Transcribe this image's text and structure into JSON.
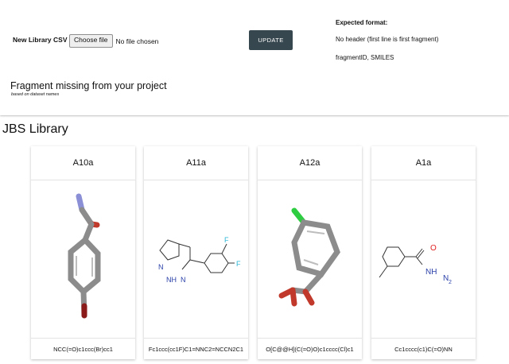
{
  "upload": {
    "label": "New Library CSV",
    "choose_label": "Choose file",
    "no_file_text": "No file chosen",
    "update_label": "UPDATE"
  },
  "format": {
    "title": "Expected format:",
    "line1": "No header (first line is first fragment)",
    "line2": "fragmentID, SMILES"
  },
  "missing": {
    "title": "Fragment missing from your project",
    "subtitle": "based on dataset names"
  },
  "library": {
    "title": "JBS Library",
    "cards": [
      {
        "id": "A10a",
        "smiles": "NCC(=O)c1ccc(Br)cc1",
        "image": "3d-stick-model"
      },
      {
        "id": "A11a",
        "smiles": "Fc1ccc(cc1F)C1=NNC2=NCCN2C1",
        "image": "2d-structure",
        "atom_labels": {
          "f1": "F",
          "f2": "F",
          "n1": "N",
          "n2": "NH",
          "n3": "N"
        }
      },
      {
        "id": "A12a",
        "smiles": "O[C@@H](C(=O)O)c1cccc(Cl)c1",
        "image": "3d-stick-model"
      },
      {
        "id": "A1a",
        "smiles": "Cc1cccc(c1)C(=O)NN",
        "image": "2d-structure",
        "atom_labels": {
          "o": "O",
          "nh": "NH",
          "n": "N",
          "h2": "2"
        }
      }
    ]
  },
  "colors": {
    "update_button": "#37474f",
    "carbon": "#8c8c8c",
    "oxygen": "#c0392b",
    "nitrogen": "#8a8fd6",
    "bromine": "#8b1a1a",
    "chlorine": "#2ecc40",
    "fluorine": "#29b6d6",
    "nitrogen_2d": "#2a3fa8",
    "oxygen_2d": "#e02020"
  }
}
